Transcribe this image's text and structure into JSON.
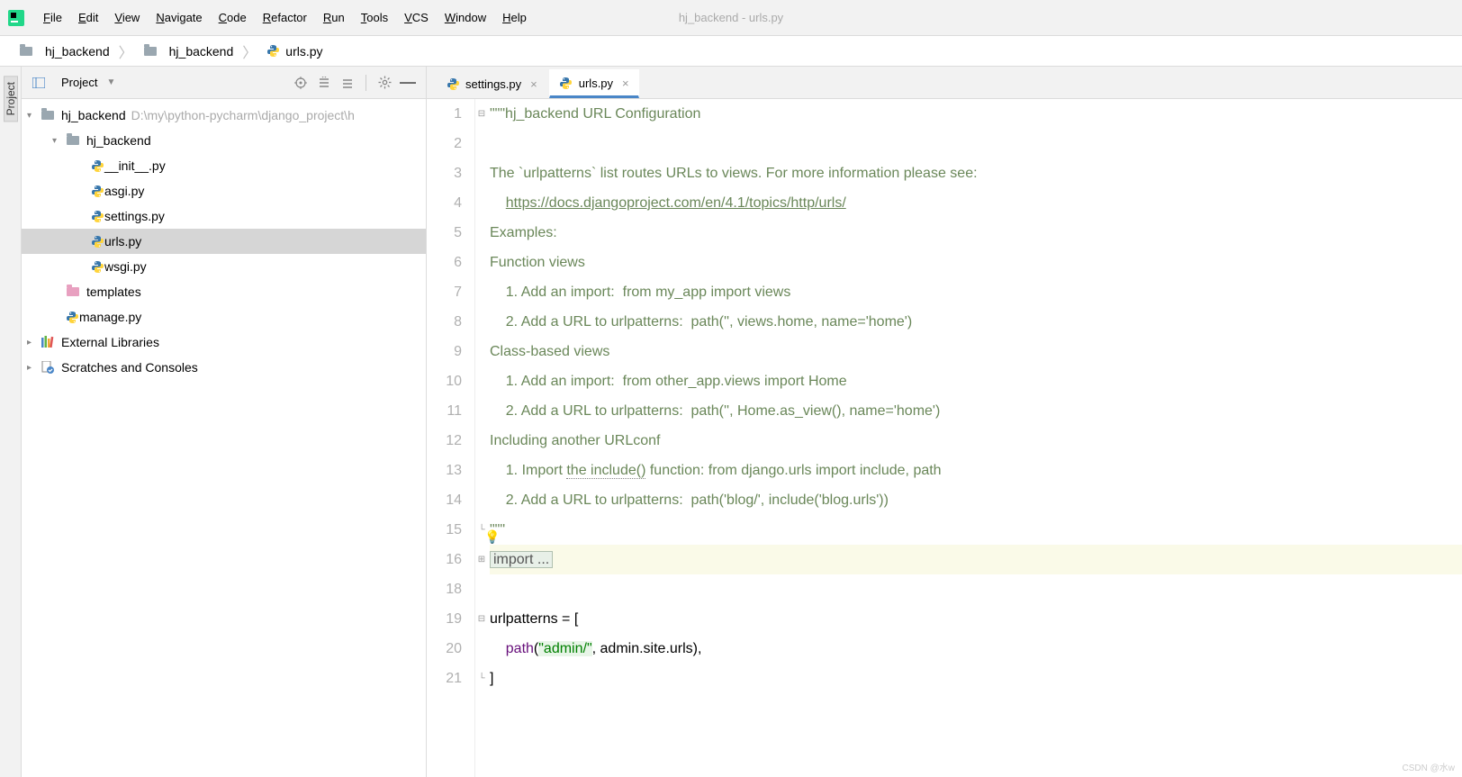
{
  "window": {
    "title": "hj_backend - urls.py"
  },
  "menu": [
    "File",
    "Edit",
    "View",
    "Navigate",
    "Code",
    "Refactor",
    "Run",
    "Tools",
    "VCS",
    "Window",
    "Help"
  ],
  "breadcrumbs": [
    {
      "label": "hj_backend",
      "icon": "folder"
    },
    {
      "label": "hj_backend",
      "icon": "folder"
    },
    {
      "label": "urls.py",
      "icon": "python"
    }
  ],
  "rail": {
    "project": "Project"
  },
  "project_panel": {
    "title": "Project",
    "tree": [
      {
        "depth": 0,
        "arrow": "down",
        "icon": "folder",
        "label": "hj_backend",
        "path": "D:\\my\\python-pycharm\\django_project\\h"
      },
      {
        "depth": 1,
        "arrow": "down",
        "icon": "folder",
        "label": "hj_backend"
      },
      {
        "depth": 2,
        "arrow": "",
        "icon": "python",
        "label": "__init__.py"
      },
      {
        "depth": 2,
        "arrow": "",
        "icon": "python",
        "label": "asgi.py"
      },
      {
        "depth": 2,
        "arrow": "",
        "icon": "python",
        "label": "settings.py"
      },
      {
        "depth": 2,
        "arrow": "",
        "icon": "python",
        "label": "urls.py",
        "selected": true
      },
      {
        "depth": 2,
        "arrow": "",
        "icon": "python",
        "label": "wsgi.py"
      },
      {
        "depth": 1,
        "arrow": "",
        "icon": "folder-pink",
        "label": "templates"
      },
      {
        "depth": 1,
        "arrow": "",
        "icon": "python",
        "label": "manage.py"
      },
      {
        "depth": 0,
        "arrow": "right",
        "icon": "library",
        "label": "External Libraries"
      },
      {
        "depth": 0,
        "arrow": "right",
        "icon": "scratch",
        "label": "Scratches and Consoles"
      }
    ]
  },
  "tabs": [
    {
      "label": "settings.py",
      "active": false
    },
    {
      "label": "urls.py",
      "active": true
    }
  ],
  "code": {
    "lines": [
      {
        "n": 1,
        "fold": "open",
        "segs": [
          {
            "t": "\"\"\"hj_backend URL Configuration",
            "cls": "docstr"
          }
        ]
      },
      {
        "n": 2,
        "segs": [
          {
            "t": "",
            "cls": "docstr"
          }
        ]
      },
      {
        "n": 3,
        "segs": [
          {
            "t": "The `urlpatterns` list routes URLs to views. For more information please see:",
            "cls": "docstr"
          }
        ]
      },
      {
        "n": 4,
        "segs": [
          {
            "t": "    ",
            "cls": "docstr"
          },
          {
            "t": "https://docs.djangoproject.com/en/4.1/topics/http/urls/",
            "cls": "link"
          }
        ]
      },
      {
        "n": 5,
        "segs": [
          {
            "t": "Examples:",
            "cls": "docstr"
          }
        ]
      },
      {
        "n": 6,
        "segs": [
          {
            "t": "Function views",
            "cls": "docstr"
          }
        ]
      },
      {
        "n": 7,
        "segs": [
          {
            "t": "    1. Add an import:  from my_app import views",
            "cls": "docstr"
          }
        ]
      },
      {
        "n": 8,
        "segs": [
          {
            "t": "    2. Add a URL to urlpatterns:  path('', views.home, name='home')",
            "cls": "docstr"
          }
        ]
      },
      {
        "n": 9,
        "segs": [
          {
            "t": "Class-based views",
            "cls": "docstr"
          }
        ]
      },
      {
        "n": 10,
        "segs": [
          {
            "t": "    1. Add an import:  from other_app.views import Home",
            "cls": "docstr"
          }
        ]
      },
      {
        "n": 11,
        "segs": [
          {
            "t": "    2. Add a URL to urlpatterns:  path('', Home.as_view(), name='home')",
            "cls": "docstr"
          }
        ]
      },
      {
        "n": 12,
        "segs": [
          {
            "t": "Including another URLconf",
            "cls": "docstr"
          }
        ]
      },
      {
        "n": 13,
        "segs": [
          {
            "t": "    1. Import ",
            "cls": "docstr"
          },
          {
            "t": "the include()",
            "cls": "docstr dot-underline"
          },
          {
            "t": " function: from django.urls import include, path",
            "cls": "docstr"
          }
        ]
      },
      {
        "n": 14,
        "segs": [
          {
            "t": "    2. Add a URL to urlpatterns:  path('blog/', include('blog.urls'))",
            "cls": "docstr"
          }
        ]
      },
      {
        "n": 15,
        "fold": "close",
        "bulb": true,
        "segs": [
          {
            "t": "\"\"\"",
            "cls": "docstr"
          }
        ]
      },
      {
        "n": 16,
        "fold": "plus",
        "hl": true,
        "segs": [
          {
            "t": "import ...",
            "cls": "foldbox"
          }
        ]
      },
      {
        "n": 18,
        "segs": [
          {
            "t": ""
          }
        ]
      },
      {
        "n": 19,
        "fold": "open",
        "segs": [
          {
            "t": "urlpatterns = ["
          }
        ]
      },
      {
        "n": 20,
        "segs": [
          {
            "t": "    "
          },
          {
            "t": "path",
            "cls": "ident"
          },
          {
            "t": "("
          },
          {
            "t": "\"admin/\"",
            "cls": "string"
          },
          {
            "t": ", admin.site.urls),"
          }
        ]
      },
      {
        "n": 21,
        "fold": "close",
        "segs": [
          {
            "t": "]"
          }
        ]
      }
    ]
  },
  "watermark": "CSDN @水w"
}
